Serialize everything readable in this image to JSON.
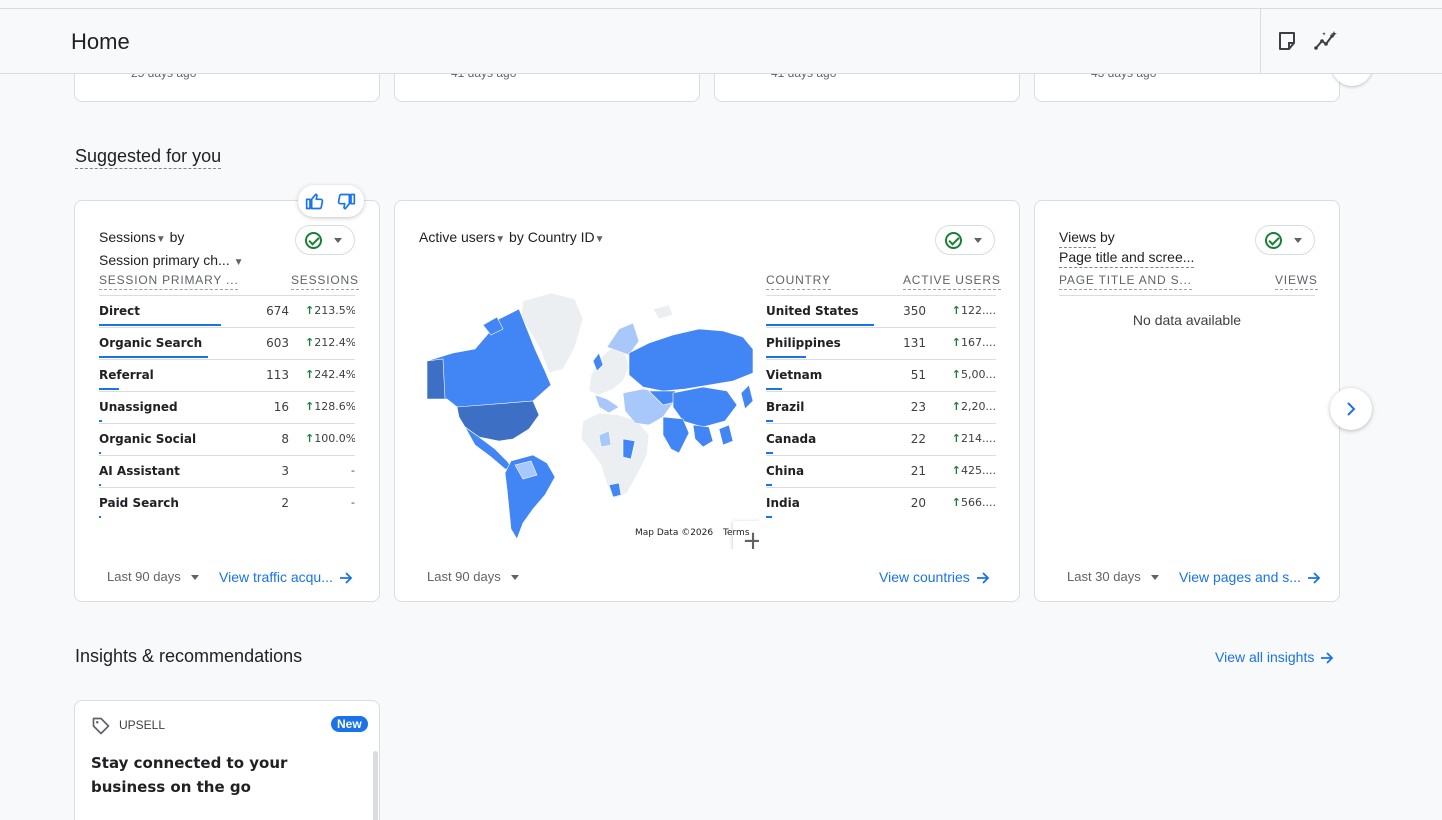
{
  "header": {
    "title": "Home",
    "icons": [
      "notes-icon",
      "insights-sparkle-icon"
    ]
  },
  "recent_cards": [
    {
      "ago": "25 days ago"
    },
    {
      "ago": "41 days ago"
    },
    {
      "ago": "41 days ago"
    },
    {
      "ago": "43 days ago"
    }
  ],
  "suggested": {
    "title": "Suggested for you"
  },
  "card1": {
    "metric": "Sessions",
    "by": "by",
    "dimension": "Session primary ch...",
    "col1": "SESSION PRIMARY ...",
    "col2": "SESSIONS",
    "rows": [
      {
        "label": "Direct",
        "value": "674",
        "change": "213.5%",
        "bar": 1.0
      },
      {
        "label": "Organic Search",
        "value": "603",
        "change": "212.4%",
        "bar": 0.895
      },
      {
        "label": "Referral",
        "value": "113",
        "change": "242.4%",
        "bar": 0.168
      },
      {
        "label": "Unassigned",
        "value": "16",
        "change": "128.6%",
        "bar": 0.024
      },
      {
        "label": "Organic Social",
        "value": "8",
        "change": "100.0%",
        "bar": 0.012
      },
      {
        "label": "AI Assistant",
        "value": "3",
        "change": "-",
        "bar": 0.005
      },
      {
        "label": "Paid Search",
        "value": "2",
        "change": "-",
        "bar": 0.003
      }
    ],
    "range": "Last 90 days",
    "link": "View traffic acqu..."
  },
  "card2": {
    "metric": "Active users",
    "by": "by",
    "dimension": "Country ID",
    "col1": "COUNTRY",
    "col2": "ACTIVE USERS",
    "rows": [
      {
        "label": "United States",
        "value": "350",
        "change": "122....",
        "bar": 1.0
      },
      {
        "label": "Philippines",
        "value": "131",
        "change": "167....",
        "bar": 0.374
      },
      {
        "label": "Vietnam",
        "value": "51",
        "change": "5,00...",
        "bar": 0.146
      },
      {
        "label": "Brazil",
        "value": "23",
        "change": "2,20...",
        "bar": 0.066
      },
      {
        "label": "Canada",
        "value": "22",
        "change": "214....",
        "bar": 0.063
      },
      {
        "label": "China",
        "value": "21",
        "change": "425....",
        "bar": 0.06
      },
      {
        "label": "India",
        "value": "20",
        "change": "566....",
        "bar": 0.057
      }
    ],
    "map_data": "Map Data ©2026",
    "map_terms": "Terms",
    "zoom_in": "+",
    "zoom_out": "−",
    "range": "Last 90 days",
    "link": "View countries"
  },
  "card3": {
    "metric": "Views",
    "by": "by",
    "dimension": "Page title and scree...",
    "col1": "PAGE TITLE AND S...",
    "col2": "VIEWS",
    "empty": "No data available",
    "range": "Last 30 days",
    "link": "View pages and s..."
  },
  "insights": {
    "title": "Insights & recommendations",
    "link": "View all insights",
    "card": {
      "kind": "UPSELL",
      "badge": "New",
      "text": "Stay connected to your business on the go"
    }
  },
  "colors": {
    "accent": "#1a73e8",
    "positive": "#188038",
    "map_high": "#3d6fc4",
    "map_mid": "#4285f4",
    "map_low": "#a8c7fa",
    "map_none": "#eceff1"
  }
}
